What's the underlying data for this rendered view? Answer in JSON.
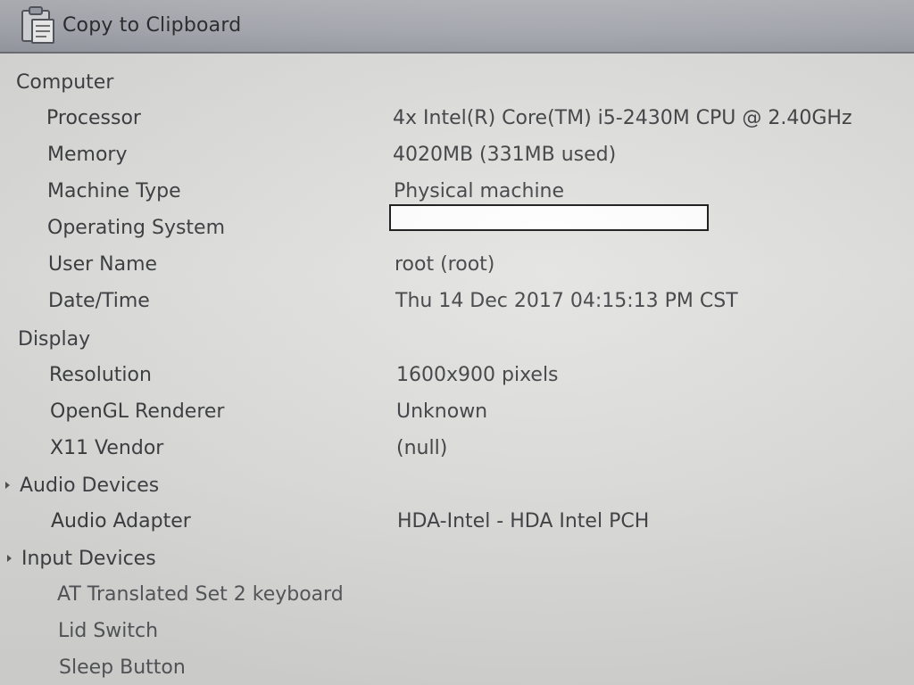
{
  "toolbar": {
    "copy_label": "Copy to Clipboard",
    "copy_icon": "clipboard-icon"
  },
  "tree": {
    "computer": {
      "label": "Computer",
      "processor_label": "Processor",
      "processor_value": "4x Intel(R) Core(TM) i5-2430M CPU @ 2.40GHz",
      "memory_label": "Memory",
      "memory_value": "4020MB (331MB used)",
      "machine_type_label": "Machine Type",
      "machine_type_value": "Physical machine",
      "os_label": "Operating System",
      "os_value": "",
      "user_label": "User Name",
      "user_value": "root (root)",
      "datetime_label": "Date/Time",
      "datetime_value": "Thu 14 Dec 2017 04:15:13 PM CST"
    },
    "display": {
      "label": "Display",
      "resolution_label": "Resolution",
      "resolution_value": "1600x900 pixels",
      "opengl_label": "OpenGL Renderer",
      "opengl_value": "Unknown",
      "x11_label": "X11 Vendor",
      "x11_value": "(null)"
    },
    "audio": {
      "label": "Audio Devices",
      "adapter_label": "Audio Adapter",
      "adapter_value": "HDA-Intel - HDA Intel PCH"
    },
    "input": {
      "label": "Input Devices",
      "items": [
        "AT Translated Set 2 keyboard",
        "Lid Switch",
        "Sleep Button"
      ]
    }
  }
}
